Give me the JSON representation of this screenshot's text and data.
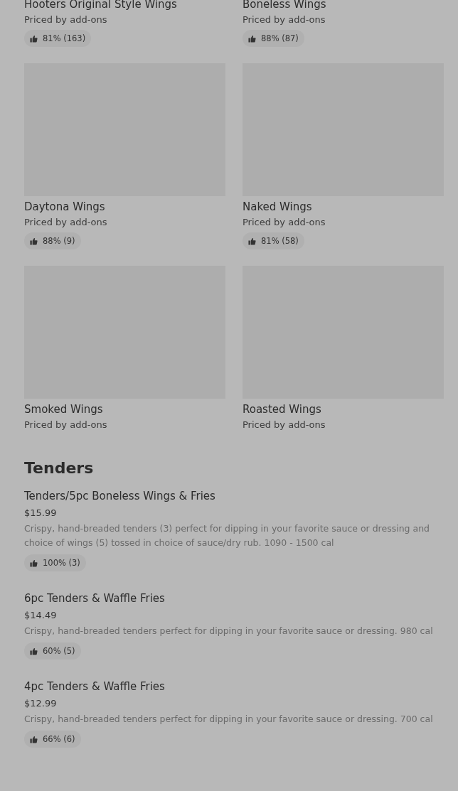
{
  "wing_items": [
    {
      "name": "Hooters Original Style Wings",
      "price": "Priced by add-ons",
      "rating": "81% (163)",
      "image": false
    },
    {
      "name": "Boneless Wings",
      "price": "Priced by add-ons",
      "rating": "88% (87)",
      "image": false
    },
    {
      "name": "Daytona Wings",
      "price": "Priced by add-ons",
      "rating": "88% (9)",
      "image": true
    },
    {
      "name": "Naked Wings",
      "price": "Priced by add-ons",
      "rating": "81% (58)",
      "image": true
    },
    {
      "name": "Smoked Wings",
      "price": "Priced by add-ons",
      "image": true
    },
    {
      "name": "Roasted Wings",
      "price": "Priced by add-ons",
      "image": true
    }
  ],
  "tenders": {
    "heading": "Tenders",
    "items": [
      {
        "name": "Tenders/5pc Boneless Wings & Fries",
        "price": "$15.99",
        "description": "Crispy, hand-breaded tenders (3) perfect for dipping in your favorite sauce or dressing and choice of wings (5) tossed in choice of sauce/dry rub. 1090 - 1500 cal",
        "rating": "100% (3)"
      },
      {
        "name": "6pc Tenders & Waffle Fries",
        "price": "$14.49",
        "description": "Crispy, hand-breaded tenders perfect for dipping in your favorite sauce or dressing. 980 cal",
        "rating": "60% (5)"
      },
      {
        "name": "4pc Tenders & Waffle Fries",
        "price": "$12.99",
        "description": "Crispy, hand-breaded tenders perfect for dipping in your favorite sauce or dressing. 700 cal",
        "rating": "66% (6)"
      }
    ]
  }
}
